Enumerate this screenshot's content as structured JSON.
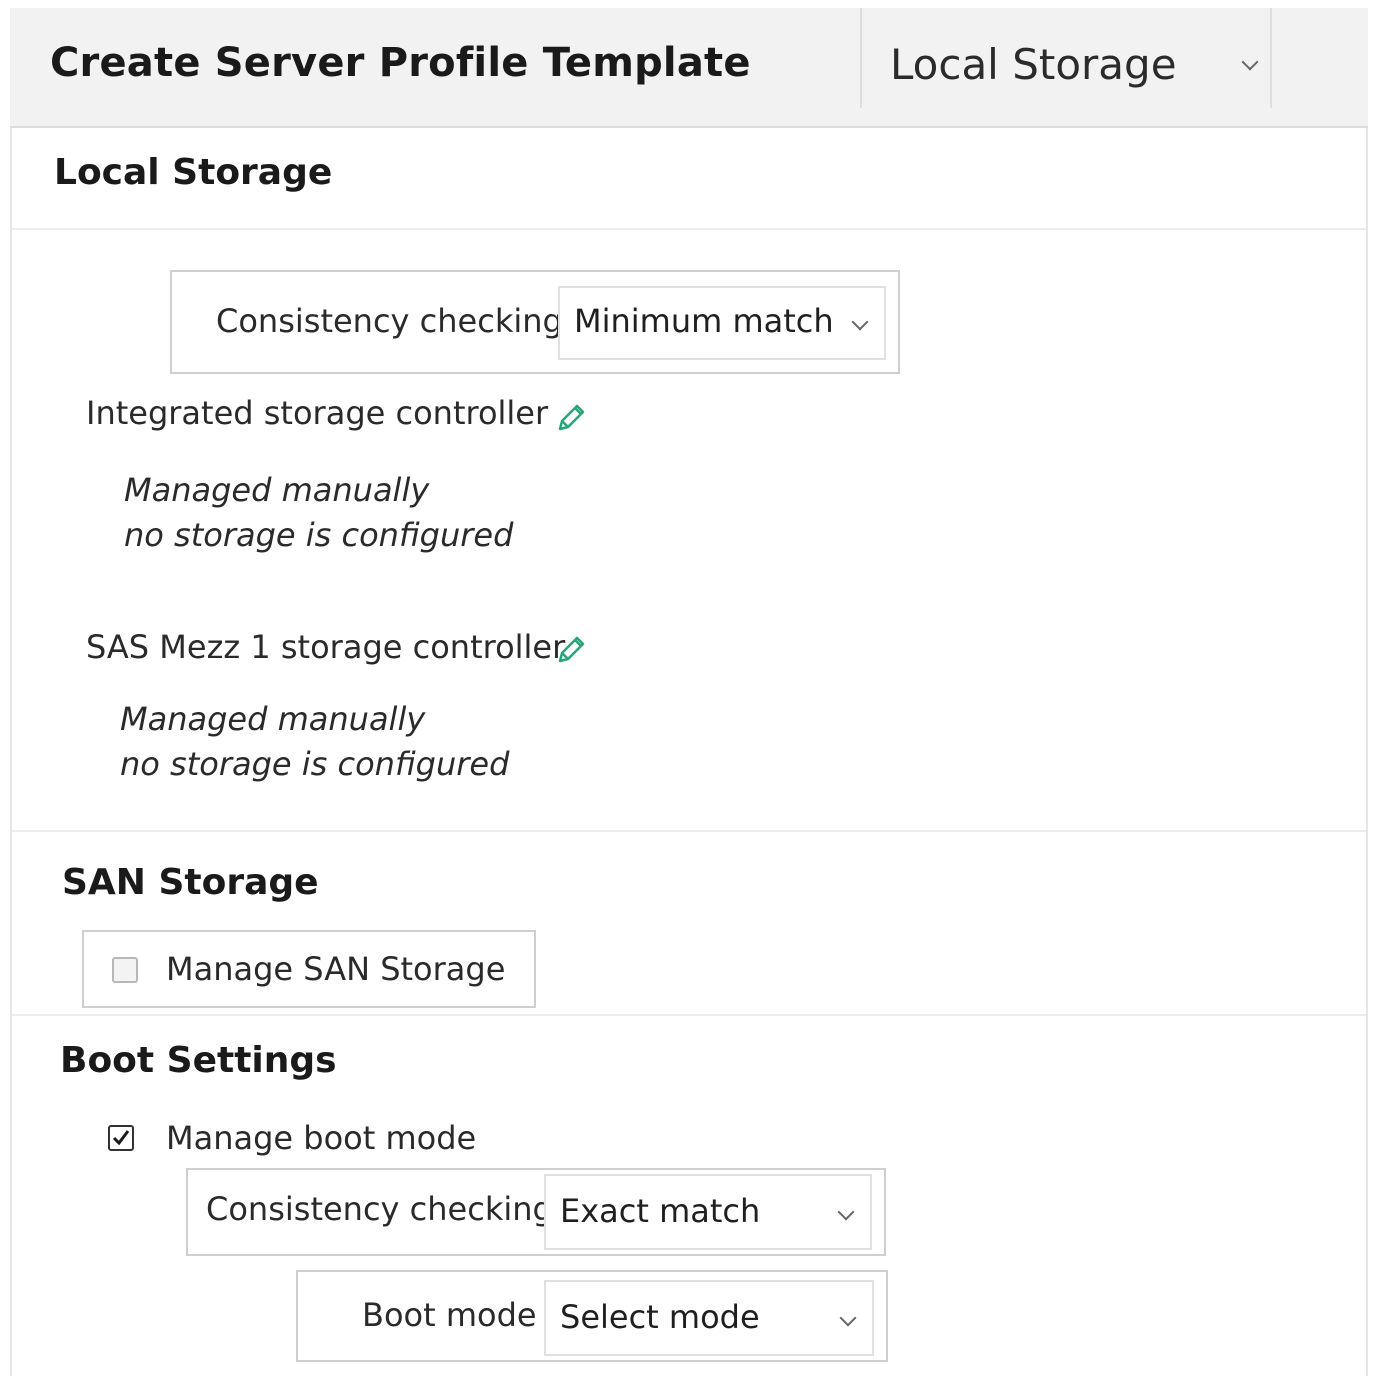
{
  "header": {
    "title": "Create Server Profile Template",
    "section_selector": "Local Storage"
  },
  "local_storage": {
    "title": "Local Storage",
    "consistency_label": "Consistency checking",
    "consistency_value": "Minimum match",
    "controllers": [
      {
        "label": "Integrated storage controller",
        "line1": "Managed manually",
        "line2": "no storage is configured"
      },
      {
        "label": "SAS Mezz 1 storage controller",
        "line1": "Managed manually",
        "line2": "no storage is configured"
      }
    ]
  },
  "san_storage": {
    "title": "SAN Storage",
    "manage_label": "Manage SAN Storage",
    "manage_checked": false
  },
  "boot_settings": {
    "title": "Boot Settings",
    "manage_boot_label": "Manage boot mode",
    "manage_boot_checked": true,
    "consistency_label": "Consistency checking",
    "consistency_value": "Exact match",
    "boot_mode_label": "Boot mode",
    "boot_mode_value": "Select mode"
  },
  "colors": {
    "accent": "#2aa37a",
    "header_bg": "#f2f2f2"
  },
  "icons": {
    "edit": "pencil-icon",
    "dropdown": "chevron-down-icon",
    "check": "checkmark-icon"
  }
}
